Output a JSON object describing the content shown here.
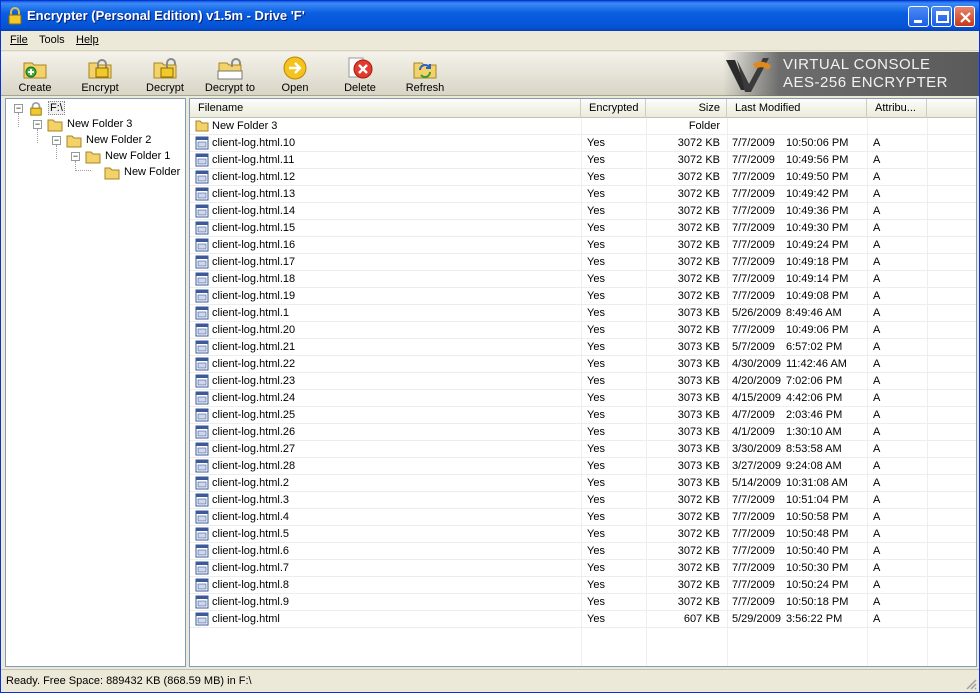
{
  "window": {
    "title": "Encrypter (Personal Edition) v1.5m - Drive 'F'"
  },
  "menu": [
    {
      "label": "File",
      "key": "F"
    },
    {
      "label": "Tools",
      "key": ""
    },
    {
      "label": "Help",
      "key": "H"
    }
  ],
  "toolbar": {
    "create": "Create",
    "encrypt": "Encrypt",
    "decrypt": "Decrypt",
    "decrypt_to": "Decrypt to",
    "open": "Open",
    "delete": "Delete",
    "refresh": "Refresh"
  },
  "brand": {
    "line1": "VIRTUAL CONSOLE",
    "line2": "AES-256 ENCRYPTER"
  },
  "tree": [
    {
      "label": "F:\\",
      "depth": 0,
      "toggle": "−",
      "icon": "lock-icon",
      "selected": true
    },
    {
      "label": "New Folder 3",
      "depth": 1,
      "toggle": "−",
      "icon": "folder-icon"
    },
    {
      "label": "New Folder 2",
      "depth": 2,
      "toggle": "−",
      "icon": "folder-icon"
    },
    {
      "label": "New Folder 1",
      "depth": 3,
      "toggle": "−",
      "icon": "folder-icon"
    },
    {
      "label": "New Folder",
      "depth": 4,
      "toggle": "",
      "icon": "folder-icon"
    }
  ],
  "columns": {
    "filename": "Filename",
    "encrypted": "Encrypted",
    "size": "Size",
    "modified": "Last Modified",
    "attrib": "Attribu..."
  },
  "files": [
    {
      "name": "New Folder 3",
      "enc": "",
      "size": "Folder",
      "date": "",
      "time": "",
      "attr": "",
      "type": "folder"
    },
    {
      "name": "client-log.html.10",
      "enc": "Yes",
      "size": "3072  KB",
      "date": "7/7/2009",
      "time": "10:50:06 PM",
      "attr": "A",
      "type": "file"
    },
    {
      "name": "client-log.html.11",
      "enc": "Yes",
      "size": "3072  KB",
      "date": "7/7/2009",
      "time": "10:49:56 PM",
      "attr": "A",
      "type": "file"
    },
    {
      "name": "client-log.html.12",
      "enc": "Yes",
      "size": "3072  KB",
      "date": "7/7/2009",
      "time": "10:49:50 PM",
      "attr": "A",
      "type": "file"
    },
    {
      "name": "client-log.html.13",
      "enc": "Yes",
      "size": "3072  KB",
      "date": "7/7/2009",
      "time": "10:49:42 PM",
      "attr": "A",
      "type": "file"
    },
    {
      "name": "client-log.html.14",
      "enc": "Yes",
      "size": "3072  KB",
      "date": "7/7/2009",
      "time": "10:49:36 PM",
      "attr": "A",
      "type": "file"
    },
    {
      "name": "client-log.html.15",
      "enc": "Yes",
      "size": "3072  KB",
      "date": "7/7/2009",
      "time": "10:49:30 PM",
      "attr": "A",
      "type": "file"
    },
    {
      "name": "client-log.html.16",
      "enc": "Yes",
      "size": "3072  KB",
      "date": "7/7/2009",
      "time": "10:49:24 PM",
      "attr": "A",
      "type": "file"
    },
    {
      "name": "client-log.html.17",
      "enc": "Yes",
      "size": "3072  KB",
      "date": "7/7/2009",
      "time": "10:49:18 PM",
      "attr": "A",
      "type": "file"
    },
    {
      "name": "client-log.html.18",
      "enc": "Yes",
      "size": "3072  KB",
      "date": "7/7/2009",
      "time": "10:49:14 PM",
      "attr": "A",
      "type": "file"
    },
    {
      "name": "client-log.html.19",
      "enc": "Yes",
      "size": "3072  KB",
      "date": "7/7/2009",
      "time": "10:49:08 PM",
      "attr": "A",
      "type": "file"
    },
    {
      "name": "client-log.html.1",
      "enc": "Yes",
      "size": "3073  KB",
      "date": "5/26/2009",
      "time": "8:49:46 AM",
      "attr": "A",
      "type": "file"
    },
    {
      "name": "client-log.html.20",
      "enc": "Yes",
      "size": "3072  KB",
      "date": "7/7/2009",
      "time": "10:49:06 PM",
      "attr": "A",
      "type": "file"
    },
    {
      "name": "client-log.html.21",
      "enc": "Yes",
      "size": "3073  KB",
      "date": "5/7/2009",
      "time": "6:57:02 PM",
      "attr": "A",
      "type": "file"
    },
    {
      "name": "client-log.html.22",
      "enc": "Yes",
      "size": "3073  KB",
      "date": "4/30/2009",
      "time": "11:42:46 AM",
      "attr": "A",
      "type": "file"
    },
    {
      "name": "client-log.html.23",
      "enc": "Yes",
      "size": "3073  KB",
      "date": "4/20/2009",
      "time": "7:02:06 PM",
      "attr": "A",
      "type": "file"
    },
    {
      "name": "client-log.html.24",
      "enc": "Yes",
      "size": "3073  KB",
      "date": "4/15/2009",
      "time": "4:42:06 PM",
      "attr": "A",
      "type": "file"
    },
    {
      "name": "client-log.html.25",
      "enc": "Yes",
      "size": "3073  KB",
      "date": "4/7/2009",
      "time": "2:03:46 PM",
      "attr": "A",
      "type": "file"
    },
    {
      "name": "client-log.html.26",
      "enc": "Yes",
      "size": "3073  KB",
      "date": "4/1/2009",
      "time": "1:30:10 AM",
      "attr": "A",
      "type": "file"
    },
    {
      "name": "client-log.html.27",
      "enc": "Yes",
      "size": "3073  KB",
      "date": "3/30/2009",
      "time": "8:53:58 AM",
      "attr": "A",
      "type": "file"
    },
    {
      "name": "client-log.html.28",
      "enc": "Yes",
      "size": "3073  KB",
      "date": "3/27/2009",
      "time": "9:24:08 AM",
      "attr": "A",
      "type": "file"
    },
    {
      "name": "client-log.html.2",
      "enc": "Yes",
      "size": "3073  KB",
      "date": "5/14/2009",
      "time": "10:31:08 AM",
      "attr": "A",
      "type": "file"
    },
    {
      "name": "client-log.html.3",
      "enc": "Yes",
      "size": "3072  KB",
      "date": "7/7/2009",
      "time": "10:51:04 PM",
      "attr": "A",
      "type": "file"
    },
    {
      "name": "client-log.html.4",
      "enc": "Yes",
      "size": "3072  KB",
      "date": "7/7/2009",
      "time": "10:50:58 PM",
      "attr": "A",
      "type": "file"
    },
    {
      "name": "client-log.html.5",
      "enc": "Yes",
      "size": "3072  KB",
      "date": "7/7/2009",
      "time": "10:50:48 PM",
      "attr": "A",
      "type": "file"
    },
    {
      "name": "client-log.html.6",
      "enc": "Yes",
      "size": "3072  KB",
      "date": "7/7/2009",
      "time": "10:50:40 PM",
      "attr": "A",
      "type": "file"
    },
    {
      "name": "client-log.html.7",
      "enc": "Yes",
      "size": "3072  KB",
      "date": "7/7/2009",
      "time": "10:50:30 PM",
      "attr": "A",
      "type": "file"
    },
    {
      "name": "client-log.html.8",
      "enc": "Yes",
      "size": "3072  KB",
      "date": "7/7/2009",
      "time": "10:50:24 PM",
      "attr": "A",
      "type": "file"
    },
    {
      "name": "client-log.html.9",
      "enc": "Yes",
      "size": "3072  KB",
      "date": "7/7/2009",
      "time": "10:50:18 PM",
      "attr": "A",
      "type": "file"
    },
    {
      "name": "client-log.html",
      "enc": "Yes",
      "size": "607  KB",
      "date": "5/29/2009",
      "time": "3:56:22 PM",
      "attr": "A",
      "type": "file"
    }
  ],
  "status": {
    "text": "Ready.    Free Space: 889432 KB (868.59 MB) in F:\\"
  },
  "colors": {
    "titlebar": "#0a5ee0",
    "accent": "#0831d9",
    "close": "#c7381a"
  }
}
